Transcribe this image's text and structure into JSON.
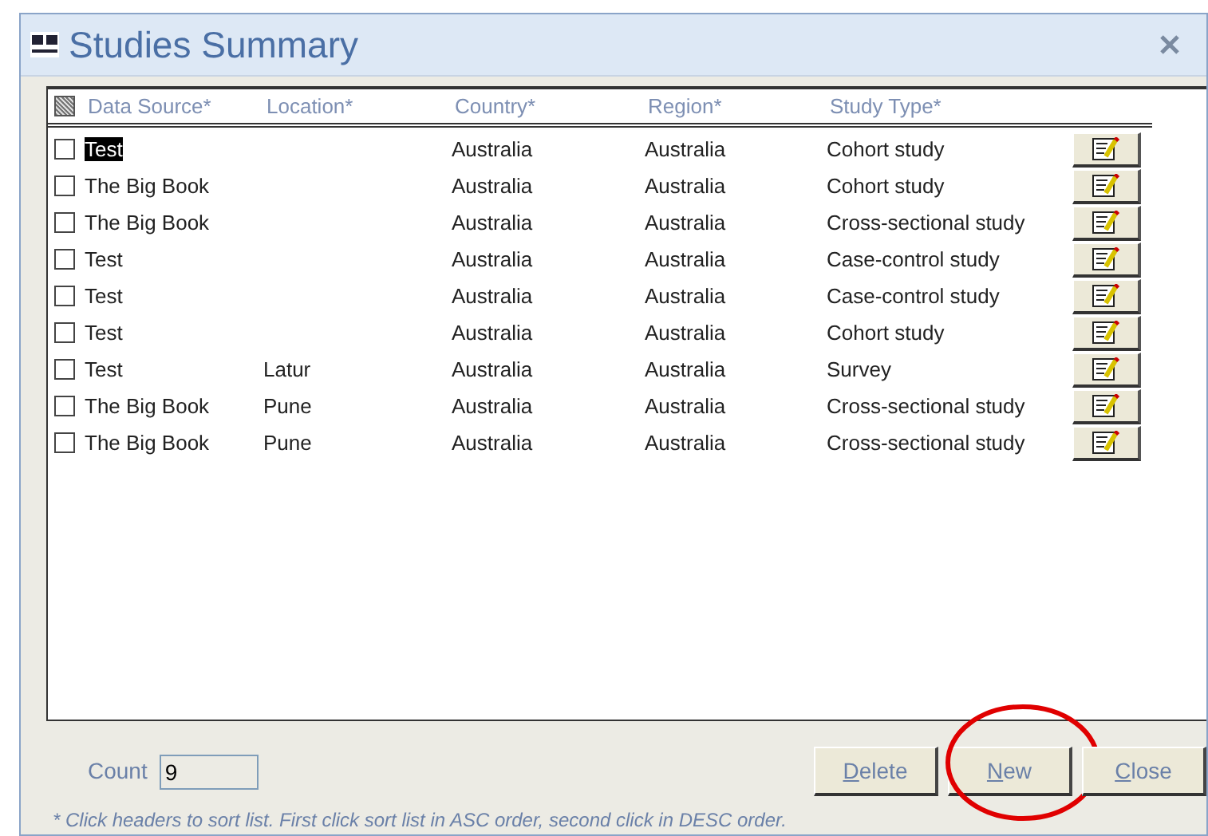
{
  "window": {
    "title": "Studies Summary"
  },
  "table": {
    "select_all": {
      "indeterminate": true
    },
    "columns": [
      "Data Source*",
      "Location*",
      "Country*",
      "Region*",
      "Study Type*"
    ],
    "rows": [
      {
        "cells": [
          "Test",
          "",
          "Australia",
          "Australia",
          "Cohort study"
        ],
        "checked": false,
        "selected": true
      },
      {
        "cells": [
          "The Big Book",
          "",
          "Australia",
          "Australia",
          "Cohort study"
        ],
        "checked": false,
        "selected": false
      },
      {
        "cells": [
          "The Big Book",
          "",
          "Australia",
          "Australia",
          "Cross-sectional study"
        ],
        "checked": false,
        "selected": false
      },
      {
        "cells": [
          "Test",
          "",
          "Australia",
          "Australia",
          "Case-control study"
        ],
        "checked": false,
        "selected": false
      },
      {
        "cells": [
          "Test",
          "",
          "Australia",
          "Australia",
          "Case-control study"
        ],
        "checked": false,
        "selected": false
      },
      {
        "cells": [
          "Test",
          "",
          "Australia",
          "Australia",
          "Cohort study"
        ],
        "checked": false,
        "selected": false
      },
      {
        "cells": [
          "Test",
          "Latur",
          "Australia",
          "Australia",
          "Survey"
        ],
        "checked": false,
        "selected": false
      },
      {
        "cells": [
          "The Big Book",
          "Pune",
          "Australia",
          "Australia",
          "Cross-sectional study"
        ],
        "checked": false,
        "selected": false
      },
      {
        "cells": [
          "The Big Book",
          "Pune",
          "Australia",
          "Australia",
          "Cross-sectional study"
        ],
        "checked": false,
        "selected": false
      }
    ]
  },
  "count": {
    "label": "Count",
    "value": "9"
  },
  "buttons": [
    {
      "label": "Delete",
      "circled": false
    },
    {
      "label": "New",
      "circled": true
    },
    {
      "label": "Close",
      "circled": false
    }
  ],
  "footnote": "* Click headers to sort list. First click sort list in ASC order, second click in DESC order."
}
